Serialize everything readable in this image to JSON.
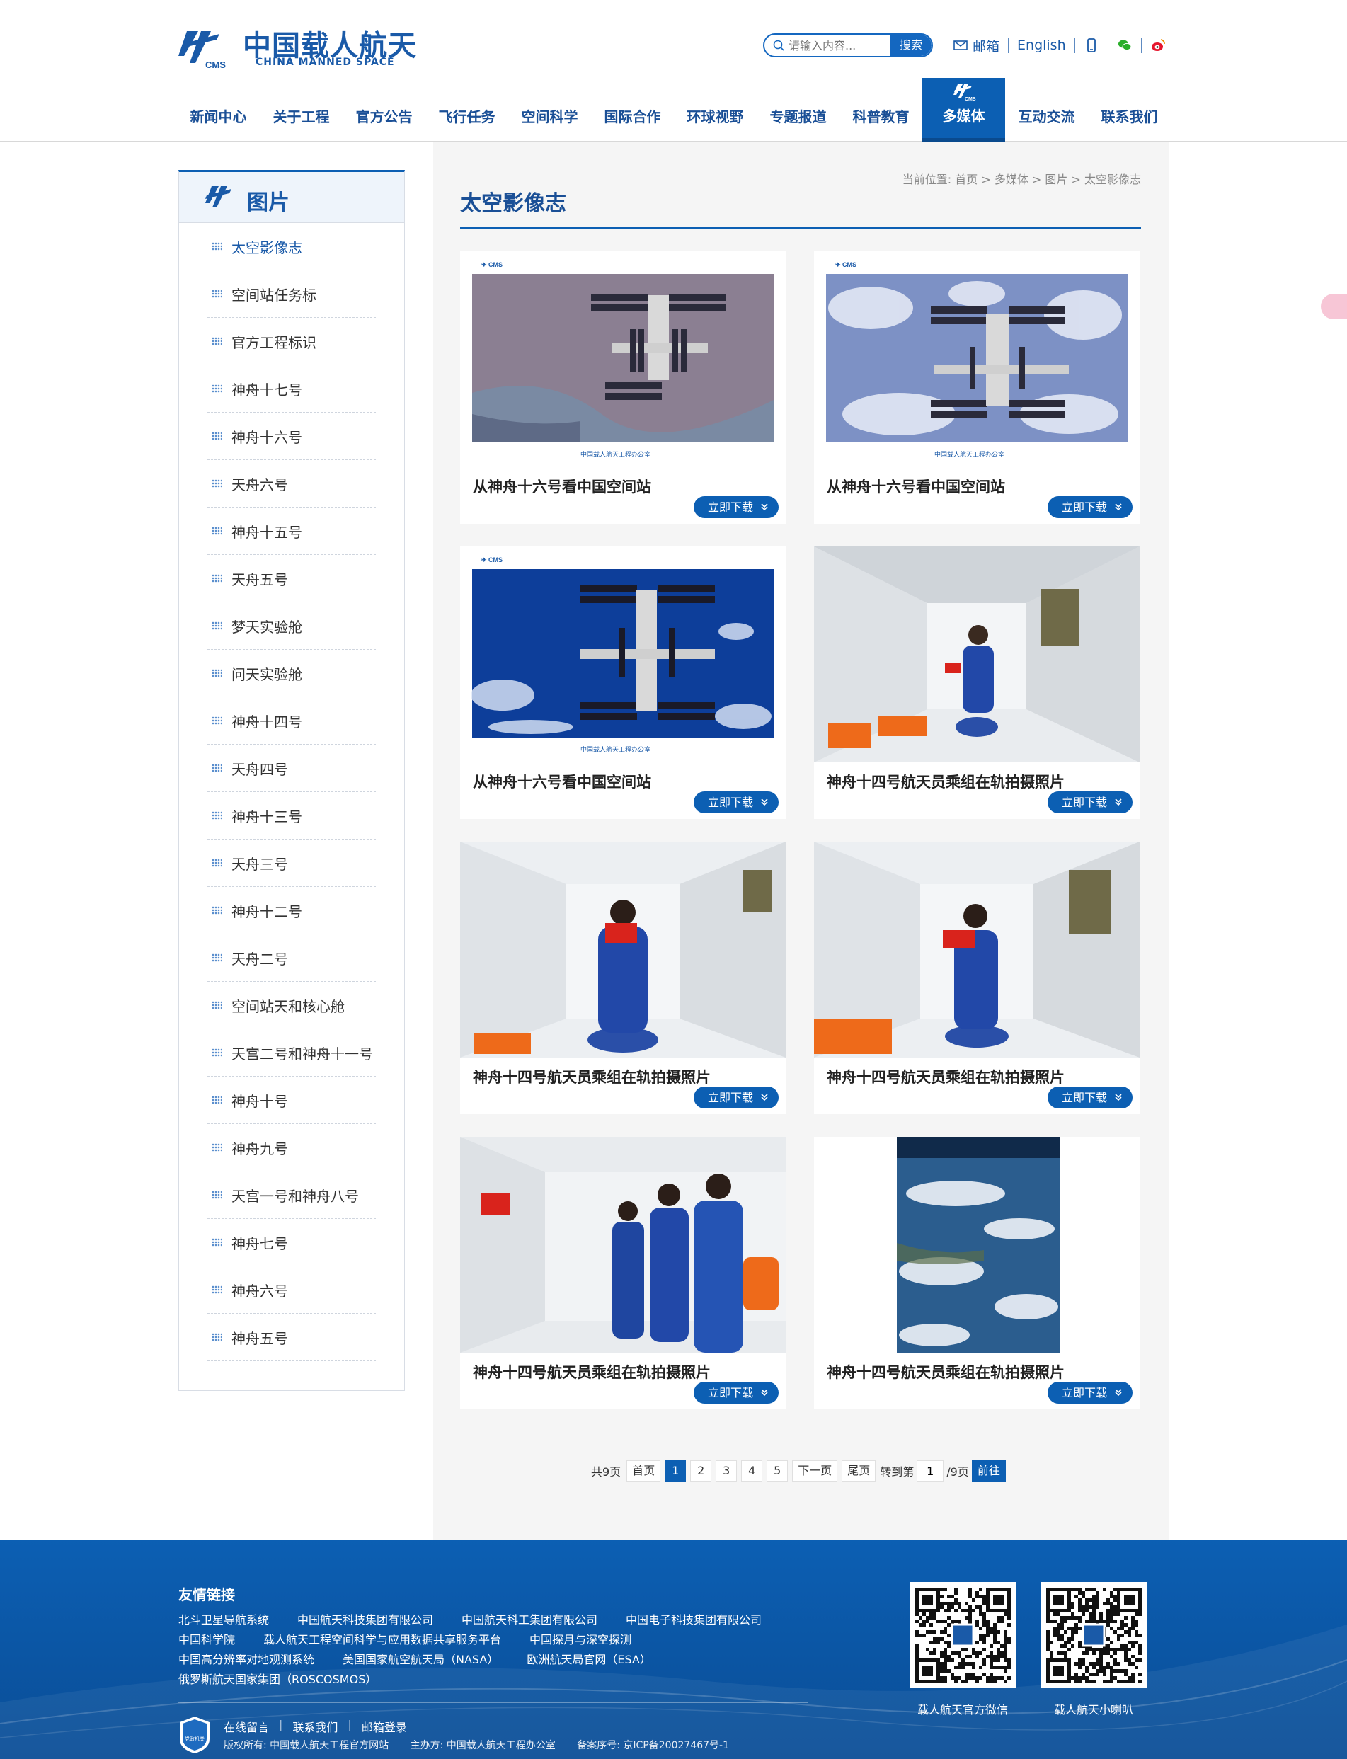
{
  "header": {
    "logo_cn": "中国载人航天",
    "logo_en": "CHINA MANNED SPACE",
    "logo_mark_text": "CMS",
    "search_placeholder": "请输入内容...",
    "search_button": "搜索",
    "mail_label": "邮箱",
    "english_label": "English"
  },
  "nav": [
    "新闻中心",
    "关于工程",
    "官方公告",
    "飞行任务",
    "空间科学",
    "国际合作",
    "环球视野",
    "专题报道",
    "科普教育",
    "多媒体",
    "互动交流",
    "联系我们"
  ],
  "sidebar": {
    "title": "图片",
    "items": [
      "太空影像志",
      "空间站任务标",
      "官方工程标识",
      "神舟十七号",
      "神舟十六号",
      "天舟六号",
      "神舟十五号",
      "天舟五号",
      "梦天实验舱",
      "问天实验舱",
      "神舟十四号",
      "天舟四号",
      "神舟十三号",
      "天舟三号",
      "神舟十二号",
      "天舟二号",
      "空间站天和核心舱",
      "天宫二号和神舟十一号",
      "神舟十号",
      "神舟九号",
      "天宫一号和神舟八号",
      "神舟七号",
      "神舟六号",
      "神舟五号"
    ]
  },
  "breadcrumb": "当前位置: 首页 > 多媒体 > 图片 > 太空影像志",
  "page_title": "太空影像志",
  "cards": [
    {
      "caption": "从神舟十六号看中国空间站",
      "download": "立即下载"
    },
    {
      "caption": "从神舟十六号看中国空间站",
      "download": "立即下载"
    },
    {
      "caption": "从神舟十六号看中国空间站",
      "download": "立即下载"
    },
    {
      "caption": "神舟十四号航天员乘组在轨拍摄照片",
      "download": "立即下载"
    },
    {
      "caption": "神舟十四号航天员乘组在轨拍摄照片",
      "download": "立即下载"
    },
    {
      "caption": "神舟十四号航天员乘组在轨拍摄照片",
      "download": "立即下载"
    },
    {
      "caption": "神舟十四号航天员乘组在轨拍摄照片",
      "download": "立即下载"
    },
    {
      "caption": "神舟十四号航天员乘组在轨拍摄照片",
      "download": "立即下载"
    }
  ],
  "pager": {
    "total": "共9页",
    "first": "首页",
    "pages": [
      "1",
      "2",
      "3",
      "4",
      "5"
    ],
    "current": "1",
    "next": "下一页",
    "last": "尾页",
    "goto_prefix": "转到第",
    "goto_value": "1",
    "goto_suffix": "/9页",
    "go": "前往"
  },
  "footer": {
    "links_title": "友情链接",
    "link_rows": [
      [
        "北斗卫星导航系统",
        "中国航天科技集团有限公司",
        "中国航天科工集团有限公司",
        "中国电子科技集团有限公司"
      ],
      [
        "中国科学院",
        "载人航天工程空间科学与应用数据共享服务平台",
        "中国探月与深空探测"
      ],
      [
        "中国高分辨率对地观测系统",
        "美国国家航空航天局（NASA）",
        "欧洲航天局官网（ESA）"
      ],
      [
        "俄罗斯航天国家集团（ROSCOSMOS）"
      ]
    ],
    "bottom_links": [
      "在线留言",
      "联系我们",
      "邮箱登录"
    ],
    "copyright": "版权所有: 中国载人航天工程官方网站",
    "sponsor": "主办方: 中国载人航天工程办公室",
    "icp": "备案序号: 京ICP备20027467号-1",
    "badge_text": "党政机关",
    "qr1_label": "载人航天官方微信",
    "qr2_label": "载人航天小喇叭"
  },
  "colors": {
    "brand": "#0c5fb3",
    "brand_text": "#1a5aa8",
    "footer_bg": "#0b5aaa",
    "content_bg": "#f5f5f5"
  }
}
